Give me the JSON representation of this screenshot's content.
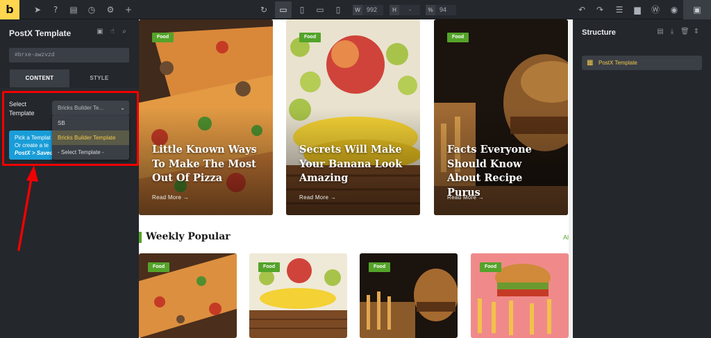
{
  "toolbar": {
    "logo": "b",
    "width_label": "W",
    "width_value": "992",
    "height_label": "H",
    "height_value": "-",
    "zoom_label": "%",
    "zoom_value": "94"
  },
  "left_panel": {
    "title": "PostX Template",
    "element_id": "#brxe-awzvzd",
    "tabs": [
      {
        "label": "CONTENT",
        "active": true
      },
      {
        "label": "STYLE",
        "active": false
      }
    ],
    "select_label": "Select Template",
    "select_value": "Bricks Builder Te...",
    "dropdown_options": [
      {
        "label": "SB",
        "selected": false
      },
      {
        "label": "Bricks Builder Template",
        "selected": true
      },
      {
        "label": "- Select Template -",
        "selected": false
      }
    ],
    "info_line1": "Pick a Templat",
    "info_line2": "Or create a te",
    "info_line3": "PostX > Saved"
  },
  "canvas": {
    "featured_posts": [
      {
        "badge": "Food",
        "title": "Little Known Ways To Make The Most Out Of Pizza",
        "read_more": "Read More"
      },
      {
        "badge": "Food",
        "title": "Secrets Will Make Your Banana Look Amazing",
        "read_more": "Read More"
      },
      {
        "badge": "Food",
        "title": "Facts Everyone Should Know About Recipe Purus",
        "read_more": "Read More"
      }
    ],
    "section_title": "Weekly Popular",
    "all_link": "All",
    "popular_posts": [
      {
        "badge": "Food"
      },
      {
        "badge": "Food"
      },
      {
        "badge": "Food"
      },
      {
        "badge": "Food"
      }
    ]
  },
  "right_panel": {
    "title": "Structure",
    "items": [
      {
        "label": "PostX Template"
      }
    ]
  },
  "colors": {
    "accent_yellow": "#ffd64f",
    "badge_green": "#54a32a",
    "highlight_red": "#f10000",
    "info_blue": "#199dd8"
  }
}
